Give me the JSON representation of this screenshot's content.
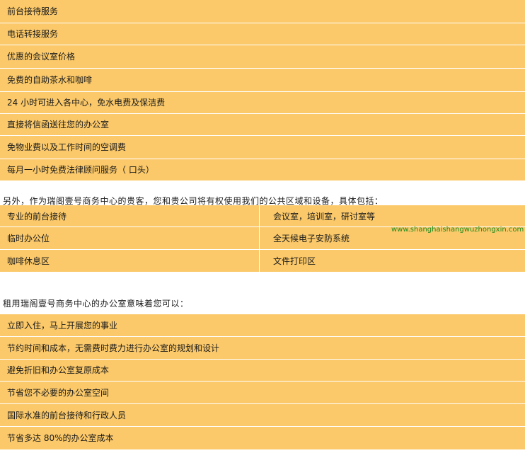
{
  "services": [
    "前台接待服务",
    "电话转接服务",
    "优惠的会议室价格",
    "免费的自助茶水和咖啡",
    "24 小时可进入各中心，免水电费及保洁费",
    "直接将信函送往您的办公室",
    "免物业费以及工作时间的空调费",
    "每月一小时免费法律顾问服务（ 口头）"
  ],
  "facilities_intro": "另外，作为瑞阁壹号商务中心的贵客，您和贵公司将有权使用我们的公共区域和设备，具体包括：",
  "facilities": [
    [
      "专业的前台接待",
      "会议室，培训室，研讨室等"
    ],
    [
      "临时办公位",
      "全天候电子安防系统"
    ],
    [
      "咖啡休息区",
      "文件打印区"
    ]
  ],
  "watermark_url": "www.shanghaishangwuzhongxin.com",
  "benefits_intro": "租用瑞阁壹号商务中心的办公室意味着您可以：",
  "benefits": [
    "立即入住，马上开展您的事业",
    "节约时间和成本，无需费时费力进行办公室的规划和设计",
    "避免折旧和办公室复原成本",
    "节省您不必要的办公室空间",
    "国际水准的前台接待和行政人员",
    "节省多达 80%的办公室成本"
  ],
  "colors": {
    "row_bg": "#fbc96a",
    "url_green": "#1e8a1e"
  }
}
